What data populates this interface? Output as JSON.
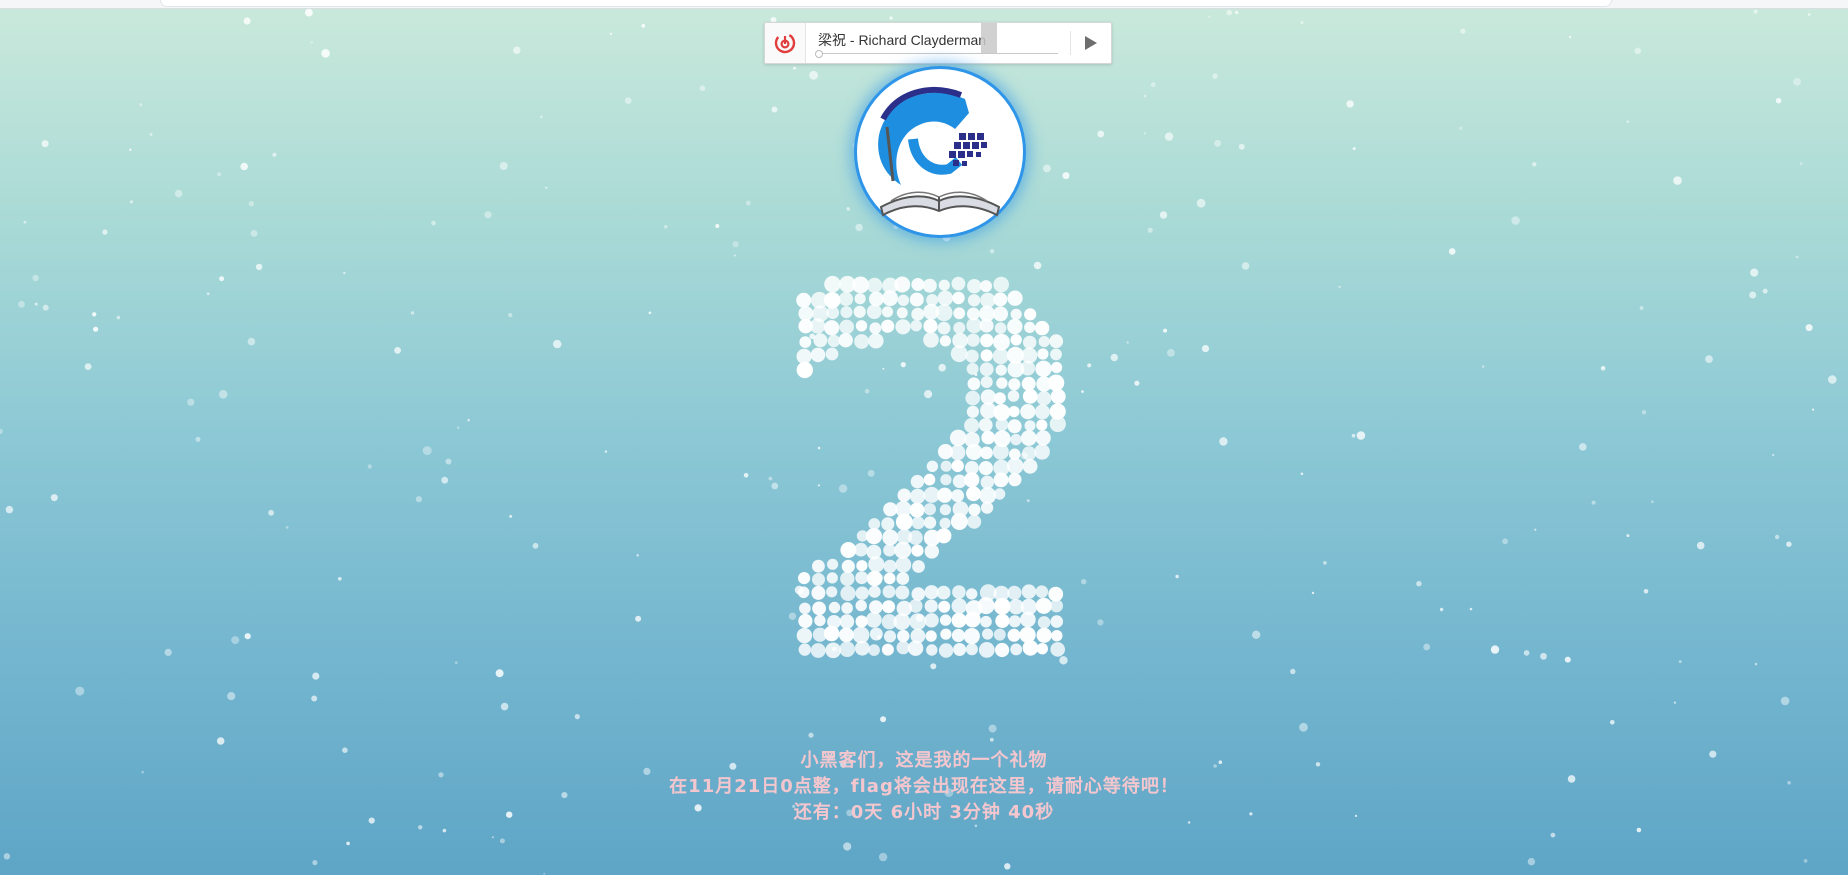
{
  "player": {
    "title": "梁祝 - Richard Clayderman",
    "app_icon": "netease-music-icon",
    "play_icon": "play-icon",
    "progress": 0.0
  },
  "avatar": {
    "icon": "book-logo-icon"
  },
  "countdown": {
    "digit": "2"
  },
  "message": {
    "line1": "小黑客们，这是我的一个礼物",
    "line2": "在11月21日0点整，flag将会出现在这里，请耐心等待吧！",
    "line3": "还有：0天 6小时 3分钟 40秒"
  },
  "colors": {
    "text": "#f4c6ce",
    "accent": "#2f95e8",
    "player_icon": "#e23d3d"
  }
}
